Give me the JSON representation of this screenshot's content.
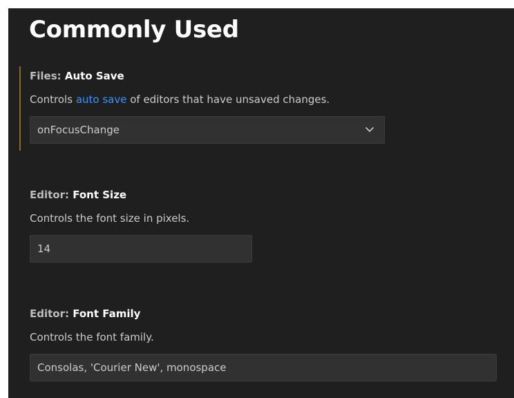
{
  "section": {
    "title": "Commonly Used"
  },
  "settings": {
    "auto_save": {
      "category": "Files: ",
      "name": "Auto Save",
      "desc_prefix": "Controls ",
      "desc_link": "auto save",
      "desc_suffix": " of editors that have unsaved changes.",
      "value": "onFocusChange"
    },
    "font_size": {
      "category": "Editor: ",
      "name": "Font Size",
      "description": "Controls the font size in pixels.",
      "value": "14"
    },
    "font_family": {
      "category": "Editor: ",
      "name": "Font Family",
      "description": "Controls the font family.",
      "value": "Consolas, 'Courier New', monospace"
    }
  },
  "colors": {
    "background": "#1f1f1f",
    "link": "#3794ff",
    "focus_indicator": "#8c6c1e",
    "input_background": "#313131"
  },
  "icons": {
    "dropdown": "chevron-down-icon"
  }
}
